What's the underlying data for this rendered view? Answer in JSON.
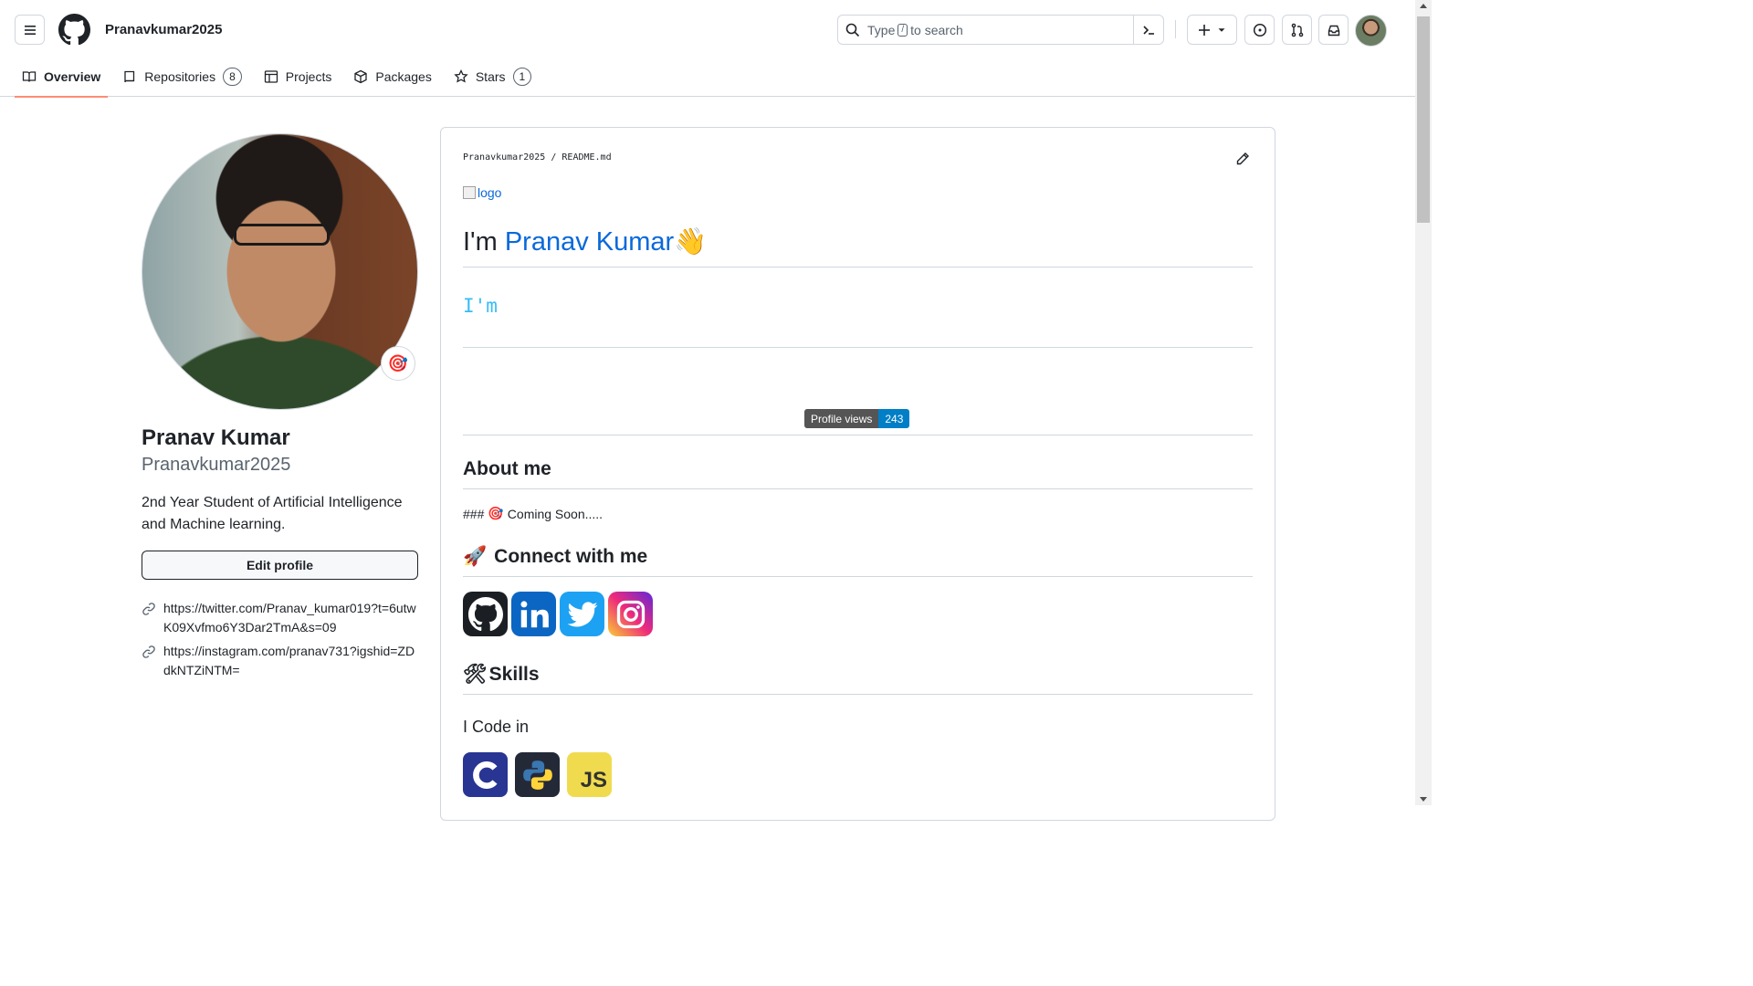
{
  "header": {
    "username": "Pranavkumar2025",
    "search_placeholder_pre": "Type",
    "search_key": "/",
    "search_placeholder_post": "to search"
  },
  "tabs": [
    {
      "label": "Overview",
      "active": true
    },
    {
      "label": "Repositories",
      "count": "8"
    },
    {
      "label": "Projects"
    },
    {
      "label": "Packages"
    },
    {
      "label": "Stars",
      "count": "1"
    }
  ],
  "profile": {
    "status_emoji": "🎯",
    "full_name": "Pranav Kumar",
    "login": "Pranavkumar2025",
    "bio": "2nd Year Student of Artificial Intelligence and Machine learning.",
    "edit_button": "Edit profile",
    "links": [
      "https://twitter.com/Pranav_kumar019?t=6utwK09Xvfmo6Y3Dar2TmA&s=09",
      "https://instagram.com/pranav731?igshid=ZDdkNTZiNTM="
    ]
  },
  "readme": {
    "path_user": "Pranavkumar2025",
    "path_sep": "/",
    "path_file": "README.md",
    "logo_alt": "logo",
    "heading_pre": "I'm ",
    "heading_name": "Pranav Kumar",
    "heading_emoji": "👋",
    "typing_text": "I'm",
    "views_label": "Profile views",
    "views_count": "243",
    "about_heading": "About me",
    "about_text_pre": "###",
    "about_emoji": "🎯",
    "about_text": "Coming Soon.....",
    "connect_emoji": "🚀",
    "connect_heading": "Connect with me",
    "social": [
      "github-icon",
      "linkedin-icon",
      "twitter-icon",
      "instagram-icon"
    ],
    "skills_emoji": "🛠",
    "skills_heading": "Skills",
    "code_heading": "I Code in",
    "languages": [
      "c-icon",
      "python-icon",
      "javascript-icon"
    ],
    "js_label": "JS"
  },
  "colors": {
    "accent_link": "#0969da",
    "tab_underline": "#fd8c73",
    "typing": "#36bcf7",
    "views_count_bg": "#007ec6"
  }
}
